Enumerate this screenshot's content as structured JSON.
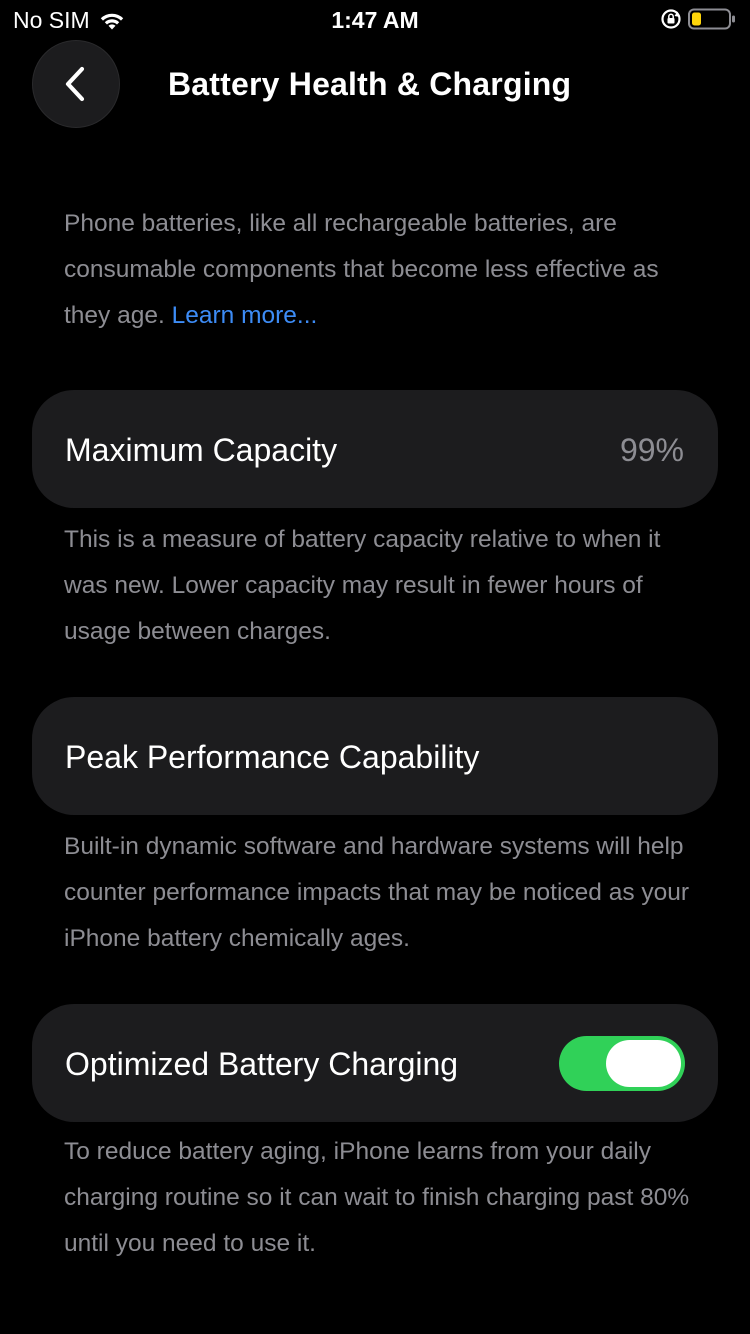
{
  "status_bar": {
    "carrier": "No SIM",
    "time": "1:47 AM",
    "wifi_icon": "wifi-icon",
    "rotation_lock_icon": "rotation-lock-icon",
    "battery_icon": "battery-low-power-icon",
    "battery_color": "#ffd60a"
  },
  "nav": {
    "back_icon": "chevron-left-icon",
    "title": "Battery Health & Charging"
  },
  "intro": {
    "text": "Phone batteries, like all rechargeable batteries, are consumable components that become less effective as they age. ",
    "link": "Learn more..."
  },
  "max_capacity": {
    "label": "Maximum Capacity",
    "value": "99%",
    "description": "This is a measure of battery capacity relative to when it was new. Lower capacity may result in fewer hours of usage between charges."
  },
  "peak_performance": {
    "label": "Peak Performance Capability",
    "description": "Built-in dynamic software and hardware systems will help counter performance impacts that may be noticed as your iPhone battery chemically ages."
  },
  "optimized_charging": {
    "label": "Optimized Battery Charging",
    "enabled": true,
    "toggle_color": "#30d158",
    "description": "To reduce battery aging, iPhone learns from your daily charging routine so it can wait to finish charging past 80% until you need to use it."
  }
}
